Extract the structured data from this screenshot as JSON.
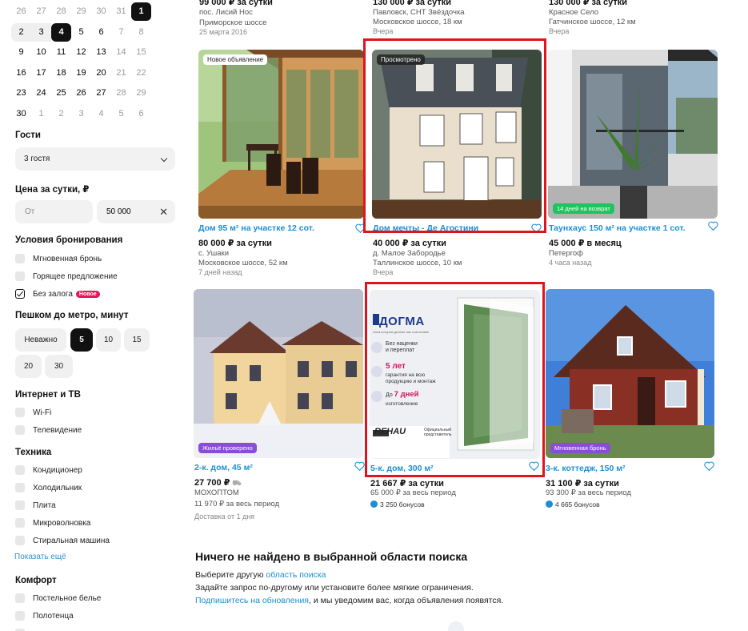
{
  "calendar": {
    "rows": [
      [
        {
          "d": "26",
          "m": true
        },
        {
          "d": "27",
          "m": true
        },
        {
          "d": "28",
          "m": true
        },
        {
          "d": "29",
          "m": true
        },
        {
          "d": "30",
          "m": true
        },
        {
          "d": "31",
          "m": true
        },
        {
          "d": "1",
          "s": true
        }
      ],
      [
        {
          "d": "2",
          "r": "start"
        },
        {
          "d": "3",
          "r": "mid"
        },
        {
          "d": "4",
          "s": true
        },
        {
          "d": "5"
        },
        {
          "d": "6"
        },
        {
          "d": "7",
          "m": true
        },
        {
          "d": "8",
          "m": true
        }
      ],
      [
        {
          "d": "9"
        },
        {
          "d": "10"
        },
        {
          "d": "11"
        },
        {
          "d": "12"
        },
        {
          "d": "13"
        },
        {
          "d": "14",
          "m": true
        },
        {
          "d": "15",
          "m": true
        }
      ],
      [
        {
          "d": "16"
        },
        {
          "d": "17"
        },
        {
          "d": "18"
        },
        {
          "d": "19"
        },
        {
          "d": "20"
        },
        {
          "d": "21",
          "m": true
        },
        {
          "d": "22",
          "m": true
        }
      ],
      [
        {
          "d": "23"
        },
        {
          "d": "24"
        },
        {
          "d": "25"
        },
        {
          "d": "26"
        },
        {
          "d": "27"
        },
        {
          "d": "28",
          "m": true
        },
        {
          "d": "29",
          "m": true
        }
      ],
      [
        {
          "d": "30"
        },
        {
          "d": "1",
          "m": true
        },
        {
          "d": "2",
          "m": true
        },
        {
          "d": "3",
          "m": true
        },
        {
          "d": "4",
          "m": true
        },
        {
          "d": "5",
          "m": true
        },
        {
          "d": "6",
          "m": true
        }
      ]
    ]
  },
  "filters": {
    "guests_title": "Гости",
    "guests_value": "3 гостя",
    "price_title": "Цена за сутки, ₽",
    "price_from_placeholder": "От",
    "price_to_value": "50 000",
    "booking_title": "Условия бронирования",
    "booking_opts": [
      "Мгновенная бронь",
      "Горящее предложение",
      "Без залога"
    ],
    "new_badge": "Новое",
    "metro_title": "Пешком до метро, минут",
    "metro_opts": [
      "Неважно",
      "5",
      "10",
      "15",
      "20",
      "30"
    ],
    "internet_title": "Интернет и ТВ",
    "internet_opts": [
      "Wi-Fi",
      "Телевидение"
    ],
    "tech_title": "Техника",
    "tech_opts": [
      "Кондиционер",
      "Холодильник",
      "Плита",
      "Микроволновка",
      "Стиральная машина"
    ],
    "show_more": "Показать ещё",
    "comfort_title": "Комфорт",
    "comfort_opts": [
      "Постельное белье",
      "Полотенца"
    ]
  },
  "top_row": [
    {
      "price": "99 000 ₽ за сутки",
      "l1": "пос. Лисий Нос",
      "l2": "Приморское шоссе",
      "l3": "25 марта 2016"
    },
    {
      "price": "130 000 ₽ за сутки",
      "l1": "Павловск, СНТ Звёздочка",
      "l2": "Московское шоссе, 18 км",
      "l3": "Вчера"
    },
    {
      "price": "130 000 ₽ за сутки",
      "l1": "Красное Село",
      "l2": "Гатчинское шоссе, 12 км",
      "l3": "Вчера"
    }
  ],
  "row1": [
    {
      "badge": "Новое объявление",
      "title": "Дом 95 м² на участке 12 сот.",
      "price": "80 000 ₽ за сутки",
      "l1": "с. Ушаки",
      "l2": "Московское шоссе, 52 км",
      "l3": "7 дней назад"
    },
    {
      "badge": "Просмотрено",
      "title": "Дом мечты - Де Агостини",
      "price": "40 000 ₽ за сутки",
      "l1": "д. Малое Забородье",
      "l2": "Таллинское шоссе, 10 км",
      "l3": "Вчера"
    },
    {
      "badge_bottom": "14 дней на возврат",
      "title": "Таунхаус 150 м² на участке 1 сот.",
      "price": "45 000 ₽ в месяц",
      "l1": "Петергоф",
      "l3": "4 часа назад"
    }
  ],
  "row2": [
    {
      "badge_bottom": "Жильё проверено",
      "title": "2-к. дом, 45 м²",
      "price": "27 700 ₽",
      "l1": "МОХОПТОМ",
      "l2": "11 970 ₽ за весь период",
      "l3": "Доставка от 1 дня"
    },
    {
      "title": "5-к. дом, 300 м²",
      "price": "21 667 ₽ за сутки",
      "l1": "65 000 ₽ за весь период",
      "bonus": "3 250 бонусов",
      "ad": {
        "brand": "ДОГМА",
        "tagline": "Окна которые делают вас счастливее",
        "f1": "Без наценки",
        "f1b": "и переплат",
        "f2a": "5 лет",
        "f2b": "гарантия на всю",
        "f2c": "продукцию и монтаж",
        "f3a": "До",
        "f3b": "7 дней",
        "f3c": "изготовление",
        "rehau": "REHAU",
        "partner": "Официальный",
        "partner2": "представитель"
      }
    },
    {
      "badge_bottom": "Мгновенная бронь",
      "title": "3-к. коттедж, 150 м²",
      "price": "31 100 ₽ за сутки",
      "l1": "93 300 ₽ за весь период",
      "bonus": "4 665 бонусов"
    }
  ],
  "not_found": {
    "title": "Ничего не найдено в выбранной области поиска",
    "l1_text": "Выберите другую ",
    "l1_link": "область поиска",
    "l2": "Задайте запрос по-другому или установите более мягкие ограничения.",
    "l3_link": "Подпишитесь на обновления",
    "l3_text": ", и мы уведомим вас, когда объявления появятся."
  }
}
